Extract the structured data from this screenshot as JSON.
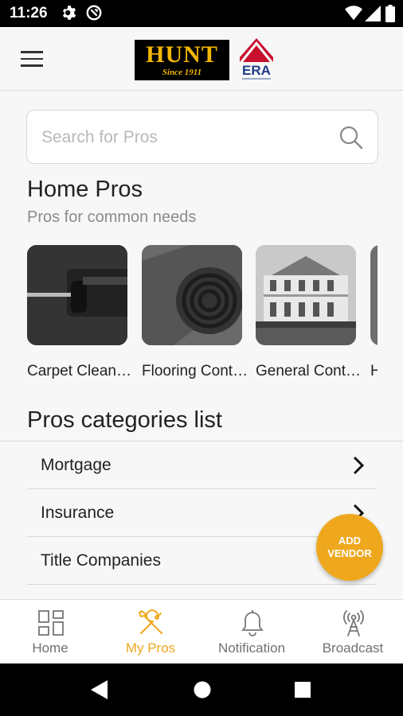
{
  "status_bar": {
    "time": "11:26"
  },
  "header": {
    "hunt_logo_text": "HUNT",
    "hunt_logo_sub": "Since 1911",
    "era_logo_text": "ERA"
  },
  "search": {
    "placeholder": "Search for Pros"
  },
  "home_pros": {
    "title": "Home Pros",
    "subtitle": "Pros for common needs",
    "cards": [
      {
        "label": "Carpet Cleaning",
        "image": "carpet-cleaning-photo"
      },
      {
        "label": "Flooring Contractors",
        "image": "flooring-roll-photo"
      },
      {
        "label": "General Contractors",
        "image": "house-photo"
      },
      {
        "label": "H",
        "image": "partial-photo"
      }
    ]
  },
  "categories": {
    "title": "Pros categories list",
    "items": [
      {
        "label": "Mortgage"
      },
      {
        "label": "Insurance"
      },
      {
        "label": "Title Companies"
      }
    ]
  },
  "fab": {
    "line1": "ADD",
    "line2": "VENDOR"
  },
  "bottom_nav": {
    "active": "My Pros",
    "items": [
      {
        "label": "Home",
        "icon": "grid-icon"
      },
      {
        "label": "My Pros",
        "icon": "tools-icon"
      },
      {
        "label": "Notification",
        "icon": "bell-icon"
      },
      {
        "label": "Broadcast",
        "icon": "broadcast-tower-icon"
      }
    ]
  },
  "colors": {
    "accent": "#efa81e",
    "logo_gold": "#f2b705",
    "era_red": "#c8102e",
    "era_blue": "#1f3c88"
  }
}
